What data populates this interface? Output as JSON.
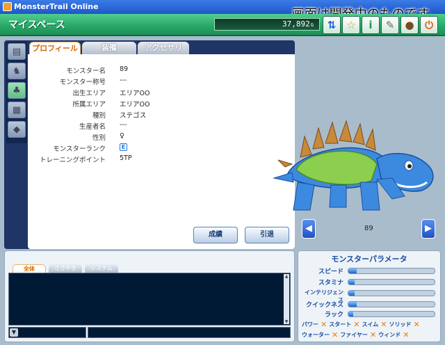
{
  "window": {
    "title": "MonsterTrail Online",
    "watermark": "画面は開発中のものです。"
  },
  "header": {
    "page_title": "マイスペース",
    "currency": "37,892"
  },
  "header_buttons": [
    "sort-icon",
    "dance-icon",
    "info-icon",
    "wrench-icon",
    "bag-icon",
    "power-icon"
  ],
  "tabs": {
    "profile": "プロフィール",
    "equipment": "装備",
    "accessory": "アクセサリ"
  },
  "profile": {
    "rows": [
      {
        "label": "モンスター名",
        "value": "89"
      },
      {
        "label": "モンスター称号",
        "value": "---"
      },
      {
        "label": "出生エリア",
        "value": "エリアOO"
      },
      {
        "label": "所属エリア",
        "value": "エリアOO"
      },
      {
        "label": "種別",
        "value": "ステゴス"
      },
      {
        "label": "生産者名",
        "value": "---"
      },
      {
        "label": "性別",
        "value": "♀"
      },
      {
        "label": "モンスターランク",
        "value": "E"
      },
      {
        "label": "トレーニングポイント",
        "value": "5TP"
      }
    ],
    "buttons": {
      "record": "成績",
      "retire": "引退"
    }
  },
  "monster": {
    "name": "89"
  },
  "chat": {
    "tabs": [
      "全体",
      "ささやき",
      "システム"
    ],
    "scope_btn": "▼",
    "scroll_up": "▲",
    "scroll_down": "▼"
  },
  "params": {
    "title": "モンスターパラメータ",
    "stats": [
      {
        "label": "スピード",
        "value": 0.1
      },
      {
        "label": "スタミナ",
        "value": 0.07
      },
      {
        "label": "インテリジェンス",
        "value": 0.07
      },
      {
        "label": "クイックネス",
        "value": 0.1
      },
      {
        "label": "ラック",
        "value": 0.06
      }
    ],
    "abilities_row1": [
      "パワー",
      "スタート",
      "スイム",
      "ソリッド"
    ],
    "abilities_row2": [
      "ウォーター",
      "ファイヤー",
      "ウィンド"
    ],
    "ability_mark": "✕"
  },
  "colors": {
    "accent_green": "#27a767",
    "panel_navy": "#1e3566",
    "param_blue": "#1a4ca0",
    "mark_orange": "#f07a10"
  }
}
